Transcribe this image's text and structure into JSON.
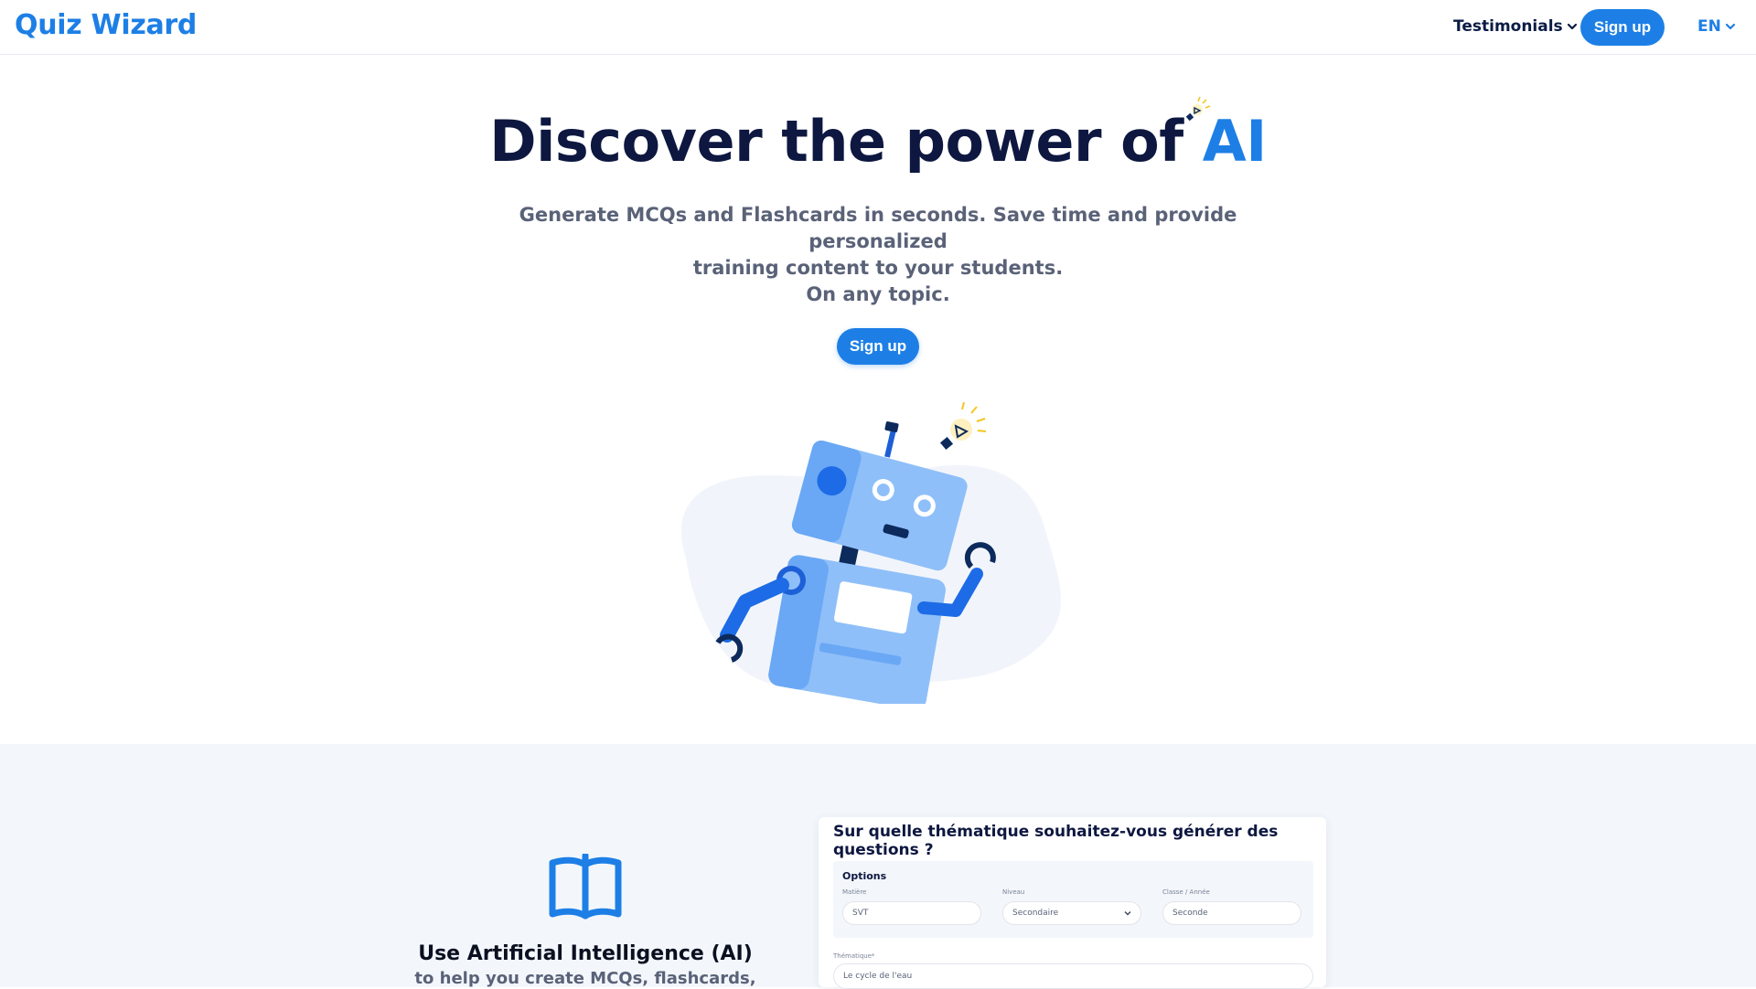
{
  "header": {
    "logo": "Quiz Wizard",
    "nav_testimonials": "Testimonials",
    "signup_label": "Sign up",
    "language": "EN"
  },
  "hero": {
    "title_main": "Discover the power of ",
    "title_accent": "AI",
    "subtitle_line1": "Generate MCQs and Flashcards in seconds. Save time and provide personalized",
    "subtitle_line2": "training content to your students.",
    "subtitle_line3": "On any topic.",
    "signup_label": "Sign up"
  },
  "feature": {
    "title": "Use Artificial Intelligence (AI)",
    "subtitle": "to help you create MCQs, flashcards,"
  },
  "form_preview": {
    "question": "Sur quelle thématique souhaitez-vous générer des questions ?",
    "options_title": "Options",
    "fields": [
      {
        "label": "Matière",
        "value": "SVT"
      },
      {
        "label": "Niveau",
        "value": "Secondaire"
      },
      {
        "label": "Classe / Année",
        "value": "Seconde"
      }
    ],
    "theme_label": "Thématique*",
    "theme_value": "Le cycle de l'eau"
  },
  "icons": {
    "testimonials_chevron": "chevron-down-icon",
    "language_chevron": "chevron-down-icon",
    "title_decoration": "lightbulb-icon",
    "illustration": "robot-illustration",
    "feature_icon": "open-book-icon"
  },
  "colors": {
    "accent": "#1d7fe6",
    "heading": "#0d1740",
    "muted_text": "#5a6278",
    "section_bg": "#f3f7fc",
    "robot_light": "#8fbff9",
    "robot_mid": "#6aa8f5",
    "robot_dark": "#0d2a5c"
  }
}
